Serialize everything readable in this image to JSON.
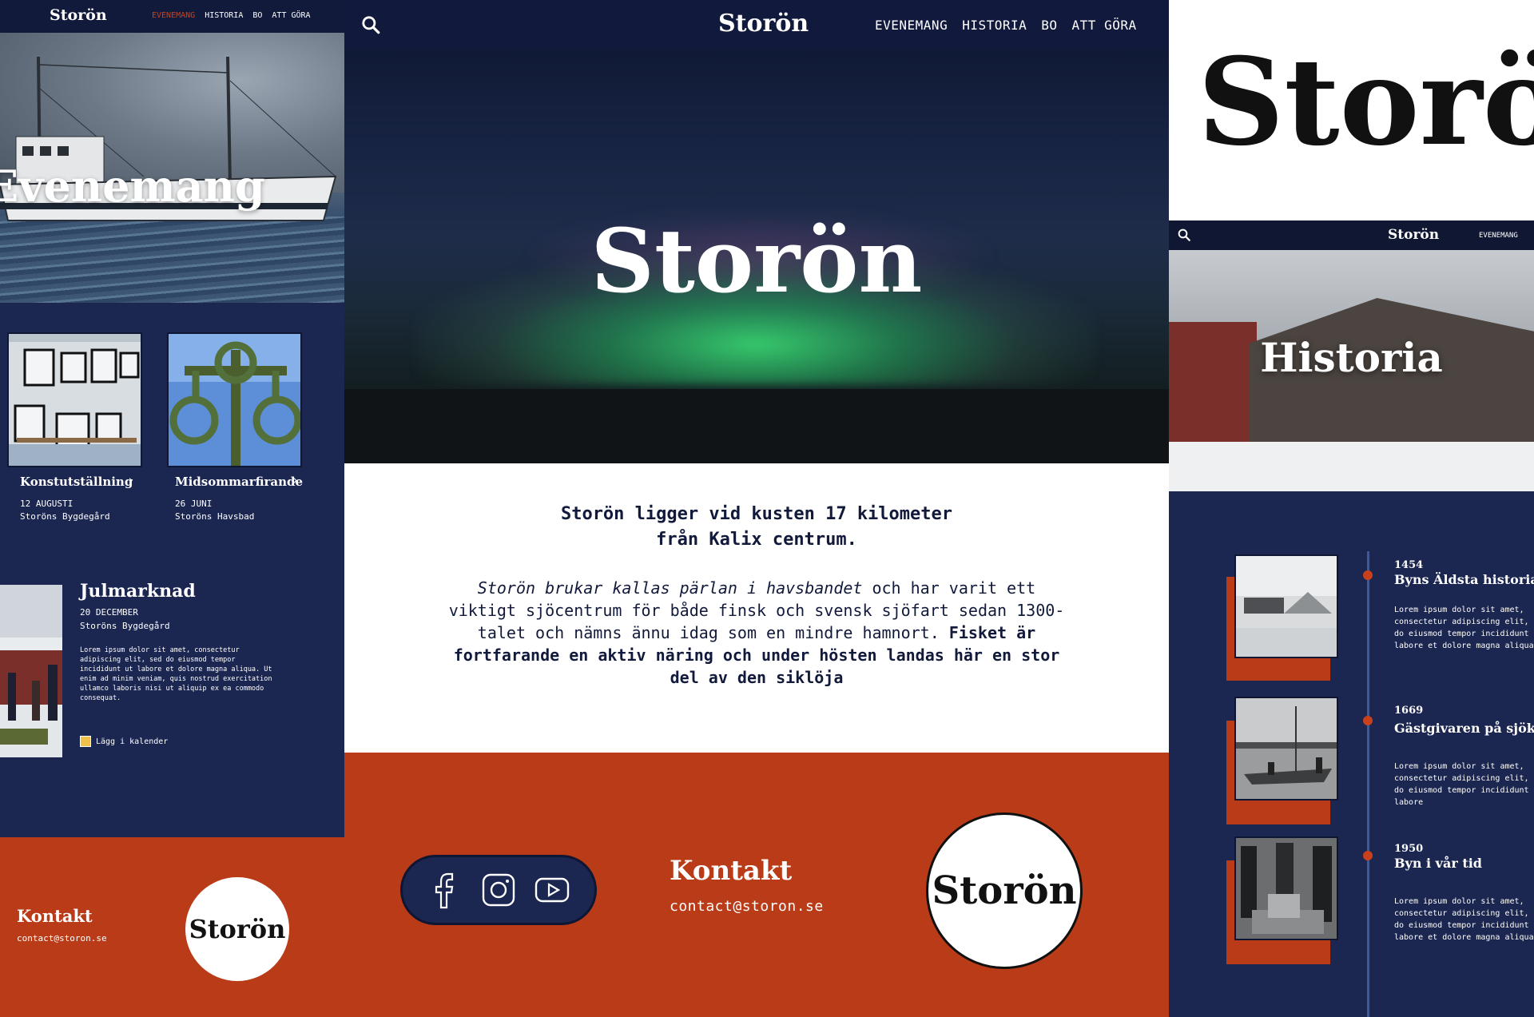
{
  "brand": "Storön",
  "colors": {
    "navy": "#1b2651",
    "rust": "#ba3b17",
    "white": "#ffffff",
    "dark": "#111a3c"
  },
  "nav": {
    "links": [
      "EVENEMANG",
      "HISTORIA",
      "BO",
      "ATT GÖRA"
    ]
  },
  "left": {
    "hero_title": "Evenemang",
    "events": [
      {
        "name": "Konstutställning",
        "date": "12 AUGUSTI",
        "place": "Storöns Bygdegård"
      },
      {
        "name": "Midsommarfirande",
        "date": "26 JUNI",
        "place": "Storöns Havsbad"
      }
    ],
    "featured": {
      "title": "Julmarknad",
      "date": "20 DECEMBER",
      "place": "Storöns Bygdegård",
      "lorem": "Lorem ipsum dolor sit amet, consectetur adipiscing elit, sed do eiusmod tempor incididunt ut labore et dolore magna aliqua. Ut enim ad minim veniam, quis nostrud exercitation ullamco laboris nisi ut aliquip ex ea commodo consequat.",
      "calendar_label": "Lägg i kalender"
    },
    "footer": {
      "contact_title": "Kontakt",
      "email": "contact@storon.se"
    }
  },
  "center": {
    "lead_line1": "Storön ligger vid kusten 17 kilometer",
    "lead_line2": "från Kalix centrum.",
    "para_italic": "Storön brukar kallas pärlan i havsbandet",
    "para_normal": " och har varit ett viktigt sjöcentrum för både finsk och svensk sjöfart sedan 1300-talet och nämns ännu idag som en mindre hamnort.",
    "para_bold": " Fisket är fortfarande en aktiv näring och under hösten landas här en stor del av den siklöja",
    "footer": {
      "contact_title": "Kontakt",
      "email": "contact@storon.se"
    },
    "social_icons": [
      "facebook-icon",
      "instagram-icon",
      "youtube-icon"
    ]
  },
  "right": {
    "nav_link": "EVENEMANG",
    "hero_title": "Historia",
    "timeline": [
      {
        "year": "1454",
        "title": "Byns Äldsta historia",
        "text": "Lorem ipsum dolor sit amet, consectetur adipiscing elit, sed do eiusmod tempor incididunt ut labore et dolore magna aliqua."
      },
      {
        "year": "1669",
        "title": "Gästgivaren på sjökrogen",
        "text": "Lorem ipsum dolor sit amet, consectetur adipiscing elit, sed do eiusmod tempor incididunt ut labore"
      },
      {
        "year": "1950",
        "title": "Byn i vår tid",
        "text": "Lorem ipsum dolor sit amet, consectetur adipiscing elit, sed do eiusmod tempor incididunt ut labore et dolore magna aliqua."
      }
    ]
  }
}
